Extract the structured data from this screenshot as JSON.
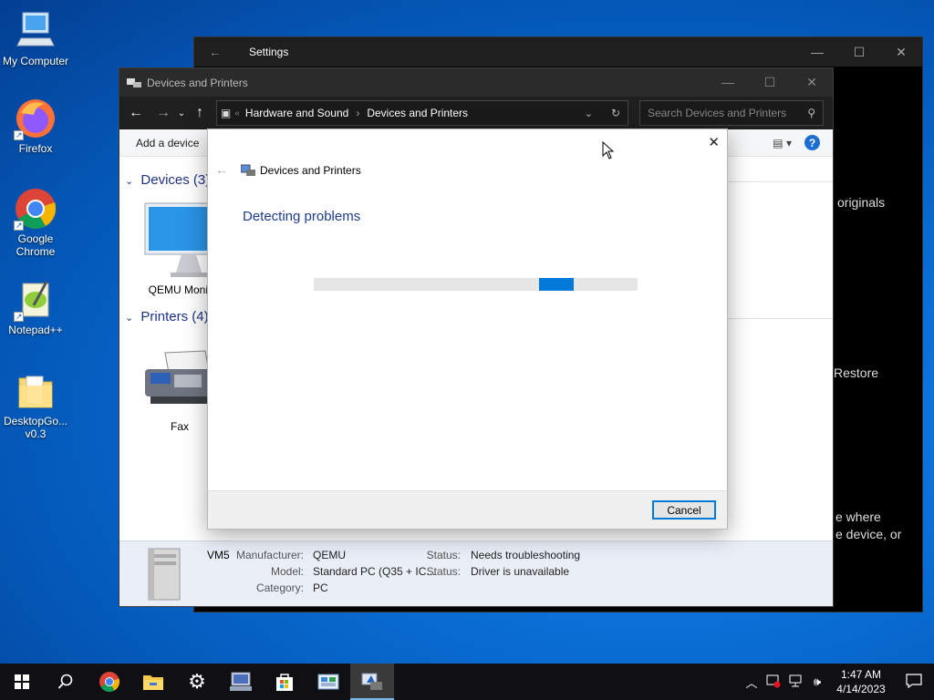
{
  "desktop": {
    "icons": [
      {
        "label": "My Computer"
      },
      {
        "label": "Firefox"
      },
      {
        "label": "Google Chrome"
      },
      {
        "label": "Notepad++"
      },
      {
        "label": "DesktopGo... v0.3"
      }
    ]
  },
  "settings_window": {
    "title": "Settings",
    "fragments": [
      "originals",
      "Restore",
      "e where",
      "e device, or"
    ]
  },
  "devices_window": {
    "title": "Devices and Printers",
    "breadcrumb": [
      "Hardware and Sound",
      "Devices and Printers"
    ],
    "search_placeholder": "Search Devices and Printers",
    "add_device": "Add a device",
    "groups": {
      "devices": "Devices (3)",
      "printers": "Printers (4)"
    },
    "device_items": [
      "QEMU Monit"
    ],
    "printer_items": [
      "Fax"
    ],
    "details": {
      "name": "VM5",
      "manufacturer_label": "Manufacturer:",
      "manufacturer": "QEMU",
      "model_label": "Model:",
      "model": "Standard PC (Q35 + IC...",
      "category_label": "Category:",
      "category": "PC",
      "status_label_1": "Status:",
      "status_1": "Needs troubleshooting",
      "status_label_2": "Status:",
      "status_2": "Driver is unavailable"
    }
  },
  "dialog": {
    "header": "Devices and Printers",
    "heading": "Detecting problems",
    "cancel": "Cancel"
  },
  "taskbar": {
    "time": "1:47 AM",
    "date": "4/14/2023"
  },
  "colors": {
    "accent": "#0078d7",
    "heading_blue": "#1e3c8c",
    "group_blue": "#1e3287"
  }
}
